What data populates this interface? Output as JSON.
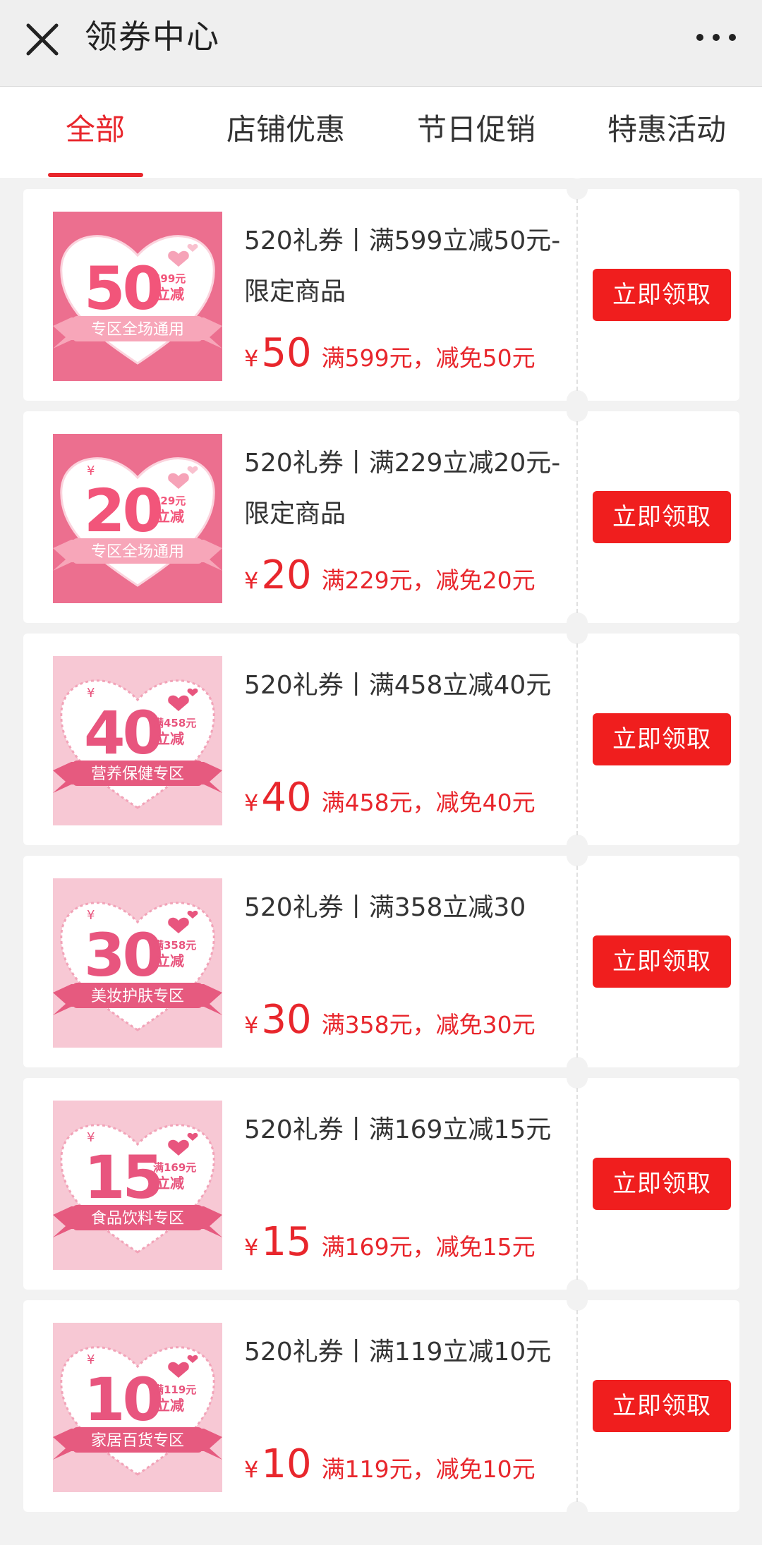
{
  "header": {
    "title": "领券中心",
    "close_icon": "close-icon",
    "more_icon": "more-icon"
  },
  "tabs": [
    {
      "label": "全部",
      "active": true
    },
    {
      "label": "店铺优惠",
      "active": false
    },
    {
      "label": "节日促销",
      "active": false
    },
    {
      "label": "特惠活动",
      "active": false
    }
  ],
  "colors": {
    "accent": "#e8262c",
    "button": "#f01e1e",
    "thumb_dark": "#ec6f8f",
    "thumb_light": "#f7c8d4",
    "ribbon": "#e65a7f"
  },
  "coupons": [
    {
      "title": "520礼券丨满599立减50元-限定商品",
      "yen": "¥",
      "amount": "50",
      "desc": "满599元，减免50元",
      "button": "立即领取",
      "thumb": {
        "big": "50",
        "small_price": "599元",
        "small_text": "立减",
        "yen": "",
        "ribbon": "专区全场通用",
        "style": "dark"
      }
    },
    {
      "title": "520礼券丨满229立减20元-限定商品",
      "yen": "¥",
      "amount": "20",
      "desc": "满229元，减免20元",
      "button": "立即领取",
      "thumb": {
        "big": "20",
        "small_price": "229元",
        "small_text": "立减",
        "yen": "¥",
        "ribbon": "专区全场通用",
        "style": "dark"
      }
    },
    {
      "title": "520礼券丨满458立减40元",
      "yen": "¥",
      "amount": "40",
      "desc": "满458元，减免40元",
      "button": "立即领取",
      "thumb": {
        "big": "40",
        "small_price": "满458元",
        "small_text": "立减",
        "yen": "¥",
        "ribbon": "营养保健专区",
        "style": "light"
      }
    },
    {
      "title": "520礼券丨满358立减30",
      "yen": "¥",
      "amount": "30",
      "desc": "满358元，减免30元",
      "button": "立即领取",
      "thumb": {
        "big": "30",
        "small_price": "满358元",
        "small_text": "立减",
        "yen": "¥",
        "ribbon": "美妆护肤专区",
        "style": "light"
      }
    },
    {
      "title": "520礼券丨满169立减15元",
      "yen": "¥",
      "amount": "15",
      "desc": "满169元，减免15元",
      "button": "立即领取",
      "thumb": {
        "big": "15",
        "small_price": "满169元",
        "small_text": "立减",
        "yen": "¥",
        "ribbon": "食品饮料专区",
        "style": "light"
      }
    },
    {
      "title": "520礼券丨满119立减10元",
      "yen": "¥",
      "amount": "10",
      "desc": "满119元，减免10元",
      "button": "立即领取",
      "thumb": {
        "big": "10",
        "small_price": "满119元",
        "small_text": "立减",
        "yen": "¥",
        "ribbon": "家居百货专区",
        "style": "light"
      }
    }
  ]
}
